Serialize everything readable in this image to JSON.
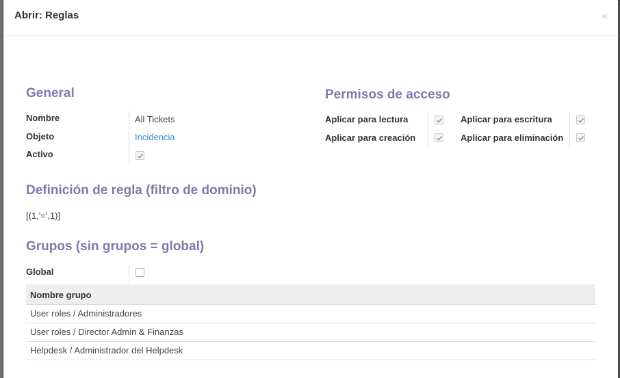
{
  "modal": {
    "title": "Abrir: Reglas",
    "close_label": "×"
  },
  "general": {
    "title": "General",
    "fields": {
      "name_label": "Nombre",
      "name_value": "All Tickets",
      "object_label": "Objeto",
      "object_value": "Incidencia",
      "active_label": "Activo",
      "active_checked": true
    }
  },
  "access": {
    "title": "Permisos de acceso",
    "read_label": "Aplicar para lectura",
    "create_label": "Aplicar para creación",
    "write_label": "Aplicar para escritura",
    "delete_label": "Aplicar para eliminación",
    "read_checked": true,
    "create_checked": true,
    "write_checked": true,
    "delete_checked": true
  },
  "rule": {
    "title": "Definición de regla (filtro de dominio)",
    "domain": "[(1,'=',1)]"
  },
  "groups": {
    "title": "Grupos (sin grupos = global)",
    "global_label": "Global",
    "global_checked": false,
    "table_header": "Nombre grupo",
    "rows": [
      "User roles / Administradores",
      "User roles / Director Admin & Finanzas",
      "Helpdesk / Administrador del Helpdesk"
    ]
  },
  "colors": {
    "section_title": "#7c7bad",
    "link": "#3e8bc5"
  }
}
